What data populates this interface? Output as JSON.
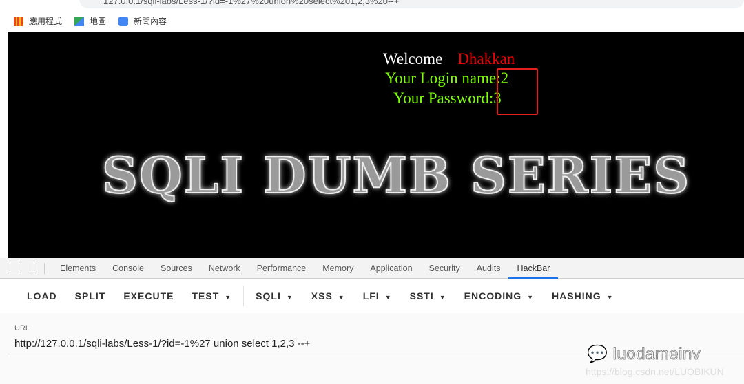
{
  "browser": {
    "address": "127.0.0.1/sqli-labs/Less-1/?id=-1%27%20union%20select%201,2,3%20--+",
    "bookmarks": [
      {
        "label": "應用程式",
        "icon": "apps-grid-icon"
      },
      {
        "label": "地圖",
        "icon": "maps-icon"
      },
      {
        "label": "新聞內容",
        "icon": "news-icon"
      }
    ]
  },
  "page": {
    "welcome": "Welcome",
    "name": "Dhakkan",
    "login": "Your Login name:2",
    "password": "Your Password:3",
    "banner": "SQLI DUMB SERIES",
    "highlight_color": "#e02020"
  },
  "devtools": {
    "tabs": [
      "Elements",
      "Console",
      "Sources",
      "Network",
      "Performance",
      "Memory",
      "Application",
      "Security",
      "Audits",
      "HackBar"
    ],
    "active": "HackBar"
  },
  "hackbar": {
    "buttons": [
      {
        "label": "LOAD"
      },
      {
        "label": "SPLIT"
      },
      {
        "label": "EXECUTE"
      },
      {
        "label": "TEST",
        "dropdown": true
      },
      {
        "label": "SQLI",
        "dropdown": true
      },
      {
        "label": "XSS",
        "dropdown": true
      },
      {
        "label": "LFI",
        "dropdown": true
      },
      {
        "label": "SSTI",
        "dropdown": true
      },
      {
        "label": "ENCODING",
        "dropdown": true
      },
      {
        "label": "HASHING",
        "dropdown": true
      }
    ],
    "url_label": "URL",
    "url_value": "http://127.0.0.1/sqli-labs/Less-1/?id=-1%27  union select 1,2,3  --+"
  },
  "watermark": {
    "text": "luodameinv",
    "url": "https://blog.csdn.net/LUOBIKUN"
  }
}
